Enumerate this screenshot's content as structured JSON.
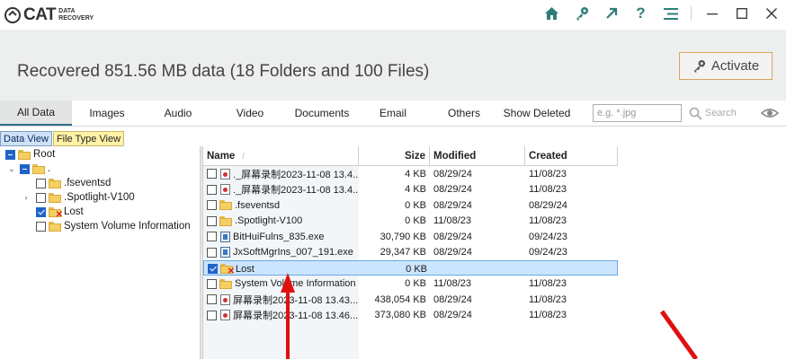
{
  "app": {
    "logo_text": "CAT",
    "logo_sub_line1": "DATA",
    "logo_sub_line2": "RECOVERY"
  },
  "toolbar_icons": [
    "home-icon",
    "key-icon",
    "share-arrow-icon",
    "help-icon",
    "menu-icon"
  ],
  "window_controls": [
    "minimize-icon",
    "maximize-icon",
    "close-icon"
  ],
  "header": {
    "recovered_text": "Recovered 851.56 MB data (18 Folders and 100 Files)",
    "activate_label": "Activate"
  },
  "filter_tabs": [
    "All Data",
    "Images",
    "Audio",
    "Video",
    "Documents",
    "Email",
    "Others",
    "Show Deleted"
  ],
  "active_filter_tab": "All Data",
  "search": {
    "placeholder": "e.g. *.jpg",
    "button_label": "Search"
  },
  "view_tabs": {
    "data_view": "Data View",
    "file_type_view": "File Type View"
  },
  "tree": {
    "root": "Root",
    "dot": ".",
    "items": [
      ".fseventsd",
      ".Spotlight-V100",
      "Lost",
      "System Volume Information"
    ]
  },
  "columns": {
    "name": "Name",
    "size": "Size",
    "modified": "Modified",
    "created": "Created"
  },
  "files": [
    {
      "name": "._屏幕录制2023-11-08 13.4...",
      "size": "4 KB",
      "modified": "08/29/24",
      "created": "11/08/23",
      "icon": "video"
    },
    {
      "name": "._屏幕录制2023-11-08 13.4...",
      "size": "4 KB",
      "modified": "08/29/24",
      "created": "11/08/23",
      "icon": "video"
    },
    {
      "name": ".fseventsd",
      "size": "0 KB",
      "modified": "08/29/24",
      "created": "08/29/24",
      "icon": "folder"
    },
    {
      "name": ".Spotlight-V100",
      "size": "0 KB",
      "modified": "11/08/23",
      "created": "11/08/23",
      "icon": "folder"
    },
    {
      "name": "BitHuiFulns_835.exe",
      "size": "30,790 KB",
      "modified": "08/29/24",
      "created": "09/24/23",
      "icon": "exe"
    },
    {
      "name": "JxSoftMgrIns_007_191.exe",
      "size": "29,347 KB",
      "modified": "08/29/24",
      "created": "09/24/23",
      "icon": "exe"
    },
    {
      "name": "Lost",
      "size": "0 KB",
      "modified": "",
      "created": "",
      "icon": "lost"
    },
    {
      "name": "System Volume Information",
      "size": "0 KB",
      "modified": "11/08/23",
      "created": "11/08/23",
      "icon": "folder"
    },
    {
      "name": "屏幕录制2023-11-08 13.43...",
      "size": "438,054 KB",
      "modified": "08/29/24",
      "created": "11/08/23",
      "icon": "video"
    },
    {
      "name": "屏幕录制2023-11-08 13.46...",
      "size": "373,080 KB",
      "modified": "08/29/24",
      "created": "11/08/23",
      "icon": "video"
    }
  ],
  "selected_file_index": 6
}
